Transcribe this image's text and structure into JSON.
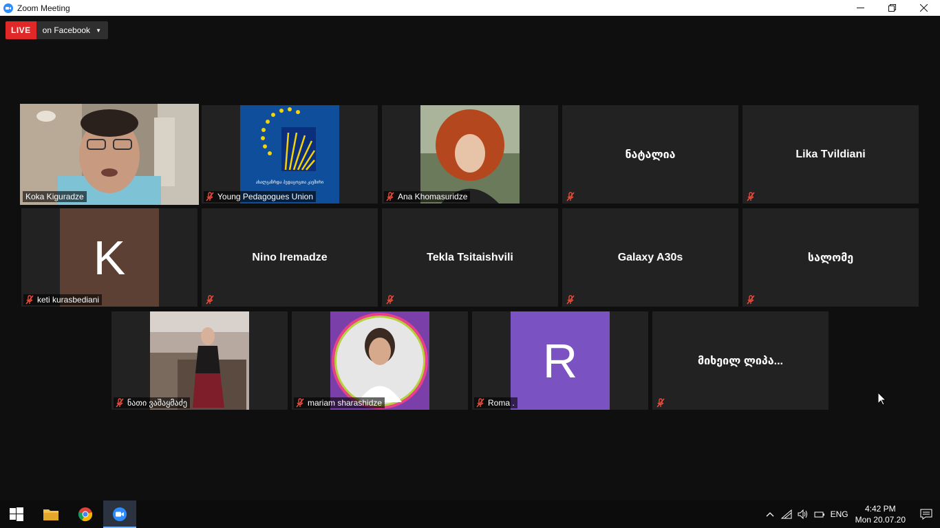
{
  "window": {
    "title": "Zoom Meeting"
  },
  "live": {
    "badge": "LIVE",
    "destination": "on Facebook"
  },
  "participants": [
    {
      "name": "Koka Kiguradze",
      "muted": false,
      "active": true
    },
    {
      "name": "Young Pedagogues Union",
      "muted": true,
      "logo_text": "ახალგაზრდა პედაგოგთა კავშირი"
    },
    {
      "name": "Ana Khomasuridze",
      "muted": true
    },
    {
      "name": "ნატალია",
      "muted": true
    },
    {
      "name": "Lika Tvildiani",
      "muted": true
    },
    {
      "name": "keti kurasbediani",
      "muted": true,
      "avatar_letter": "K",
      "avatar_color": "#5c4033"
    },
    {
      "name": "Nino Iremadze",
      "muted": true
    },
    {
      "name": "Tekla Tsitaishvili",
      "muted": true
    },
    {
      "name": "Galaxy A30s",
      "muted": true
    },
    {
      "name": "სალომე",
      "muted": true
    },
    {
      "name": "ნათი ვაშაყმაძე",
      "muted": true
    },
    {
      "name": "mariam sharashidze",
      "muted": true
    },
    {
      "name": "Roma .",
      "muted": true,
      "avatar_letter": "R",
      "avatar_color": "#7b52c1"
    },
    {
      "name": "მიხეილ ლიპა...",
      "muted": true
    }
  ],
  "taskbar": {
    "language": "ENG",
    "time": "4:42 PM",
    "date": "Mon 20.07.20"
  }
}
